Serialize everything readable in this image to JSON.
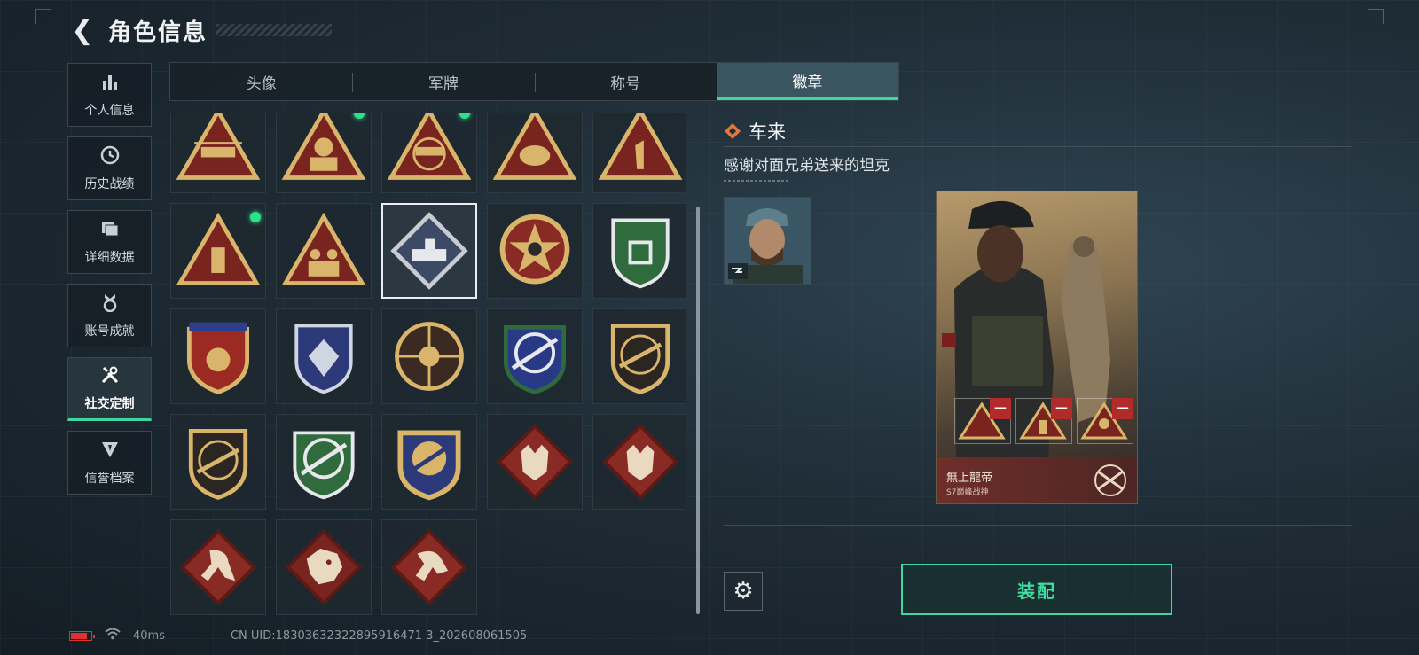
{
  "header": {
    "title": "角色信息",
    "back_icon": "back-arrow-icon"
  },
  "sidebar": {
    "items": [
      {
        "label": "个人信息",
        "icon": "bar-chart-icon",
        "active": false
      },
      {
        "label": "历史战绩",
        "icon": "clock-icon",
        "active": false
      },
      {
        "label": "详细数据",
        "icon": "folder-icon",
        "active": false
      },
      {
        "label": "账号成就",
        "icon": "medal-icon",
        "active": false
      },
      {
        "label": "社交定制",
        "icon": "tools-icon",
        "active": true
      },
      {
        "label": "信誉档案",
        "icon": "shield-badge-icon",
        "active": false
      }
    ]
  },
  "tabs": [
    {
      "label": "头像",
      "active": false
    },
    {
      "label": "军牌",
      "active": false
    },
    {
      "label": "称号",
      "active": false
    },
    {
      "label": "徽章",
      "active": true
    }
  ],
  "badge_grid": {
    "rows": 5,
    "cols": 5,
    "items": [
      {
        "icon": "helicopter-triangle-badge"
      },
      {
        "icon": "soldier-triangle-badge",
        "new": true
      },
      {
        "icon": "eri-globe-triangle-badge",
        "new": true
      },
      {
        "icon": "shell-triangle-badge"
      },
      {
        "icon": "number-one-triangle-badge"
      },
      {
        "icon": "usb-triangle-badge",
        "new": true
      },
      {
        "icon": "troops-triangle-badge"
      },
      {
        "icon": "tank-diamond-badge",
        "selected": true
      },
      {
        "icon": "star-skull-round-badge"
      },
      {
        "icon": "green-shield-badge"
      },
      {
        "icon": "red-shield-stars-badge"
      },
      {
        "icon": "blue-diamond-shield-badge"
      },
      {
        "icon": "skull-crosshair-round-badge"
      },
      {
        "icon": "blue-rifle-scope-badge"
      },
      {
        "icon": "dark-rifle-shield-badge"
      },
      {
        "icon": "gold-rifle-shield-badge"
      },
      {
        "icon": "green-rifle-scope-badge"
      },
      {
        "icon": "gold-rifle-crest-badge"
      },
      {
        "icon": "wolf-diamond-badge"
      },
      {
        "icon": "wolf-diamond-badge-2"
      },
      {
        "icon": "runner-diamond-badge"
      },
      {
        "icon": "dragon-diamond-badge"
      },
      {
        "icon": "fighter-diamond-badge"
      }
    ]
  },
  "detail": {
    "icon": "rank-diamond-icon",
    "name": "车来",
    "description": "感谢对面兄弟送来的坦克"
  },
  "card": {
    "player_name": "無上龍帝",
    "subtitle": "S7巅峰战神",
    "emblem_icon": "crossed-rifles-emblem"
  },
  "actions": {
    "settings_icon": "gear-icon",
    "equip_label": "装配"
  },
  "status_bar": {
    "ping": "40ms",
    "uid": "CN UID:18303632322895916471 3_202608061505"
  },
  "colors": {
    "accent": "#3fd6a0",
    "badge_gold": "#d8b56a",
    "badge_red": "#8a2a24",
    "new_dot": "#2de08a",
    "remove": "#b22b2b"
  }
}
